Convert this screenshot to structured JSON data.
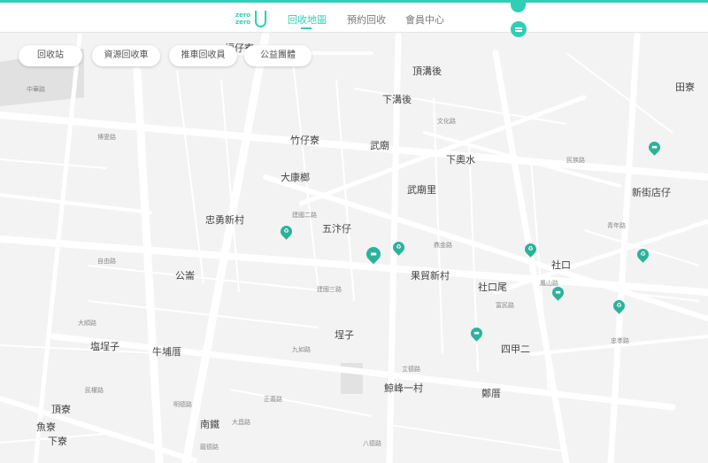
{
  "header": {
    "logo_text": [
      "zero",
      "zero"
    ],
    "nav": [
      {
        "label": "回收地圖",
        "active": true
      },
      {
        "label": "預約回收",
        "active": false
      },
      {
        "label": "會員中心",
        "active": false
      }
    ]
  },
  "filters": [
    {
      "label": "回收站"
    },
    {
      "label": "資源回收車"
    },
    {
      "label": "推車回收員"
    },
    {
      "label": "公益團體"
    }
  ],
  "map": {
    "places": [
      "頂溝後",
      "田寮",
      "下溝後",
      "竹仔寮",
      "武廟",
      "下奧水",
      "大康榔",
      "武廟里",
      "新街店仔",
      "忠勇新村",
      "五汴仔",
      "公崙",
      "果貿新村",
      "社口尾",
      "社口",
      "埕子",
      "塩埕子",
      "牛埔厝",
      "四甲二",
      "鄭厝",
      "鯨峰一村",
      "頂寮",
      "南鐵",
      "魚寮",
      "下寮",
      "福仔寮"
    ],
    "roads": [
      "中華路",
      "博愛路",
      "建國二路",
      "民族路",
      "自由路",
      "大順路",
      "九如路",
      "立德路",
      "文化路",
      "富民路",
      "鼎金路",
      "鳳山路",
      "民權路",
      "明德路",
      "正義路",
      "八德路",
      "龍德路",
      "大昌路",
      "忠孝路",
      "青年路",
      "建國三路"
    ]
  },
  "colors": {
    "accent": "#2fcfb6",
    "pin": "#2bb39a"
  },
  "icons": [
    "menu-icon",
    "recycle-station-pin-icon",
    "recycle-truck-pin-icon"
  ]
}
